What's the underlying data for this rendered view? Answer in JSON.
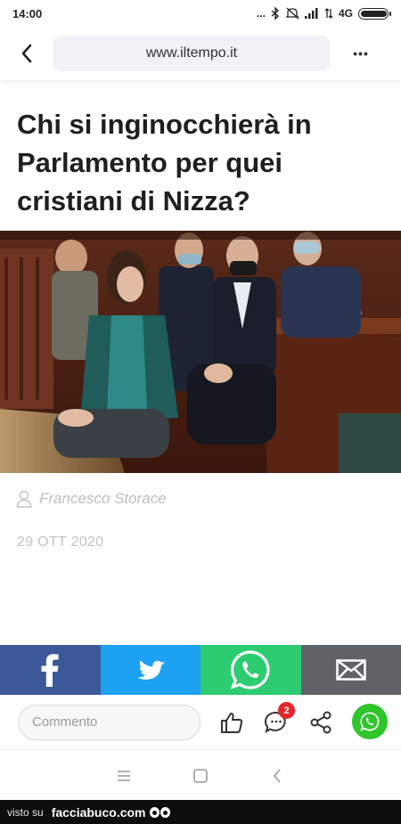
{
  "status_bar": {
    "time": "14:00",
    "dots": "...",
    "network": "4G",
    "battery_level": 0.9
  },
  "browser": {
    "url": "www.iltempo.it",
    "more_label": "•••"
  },
  "article": {
    "headline": "Chi si inginocchierà in Parlamento per quei cristiani di Nizza?",
    "author": "Francesco Storace",
    "date": "29 OTT 2020"
  },
  "share_bar": {
    "colors": {
      "facebook": "#3b5998",
      "twitter": "#1da1f2",
      "whatsapp": "#2ecc71",
      "email": "#5f6368"
    },
    "items": [
      {
        "icon": "facebook-icon"
      },
      {
        "icon": "twitter-icon"
      },
      {
        "icon": "whatsapp-icon"
      },
      {
        "icon": "email-icon"
      }
    ]
  },
  "comment_bar": {
    "placeholder": "Commento",
    "comment_count": "2",
    "icons": [
      "thumbs-up-icon",
      "comment-icon",
      "share-icon",
      "whatsapp-icon"
    ]
  },
  "nav_bar": {
    "icons": [
      "menu-icon",
      "home-icon",
      "back-icon"
    ]
  },
  "footer": {
    "prefix": "visto su",
    "brand": "facciabuco.com"
  }
}
